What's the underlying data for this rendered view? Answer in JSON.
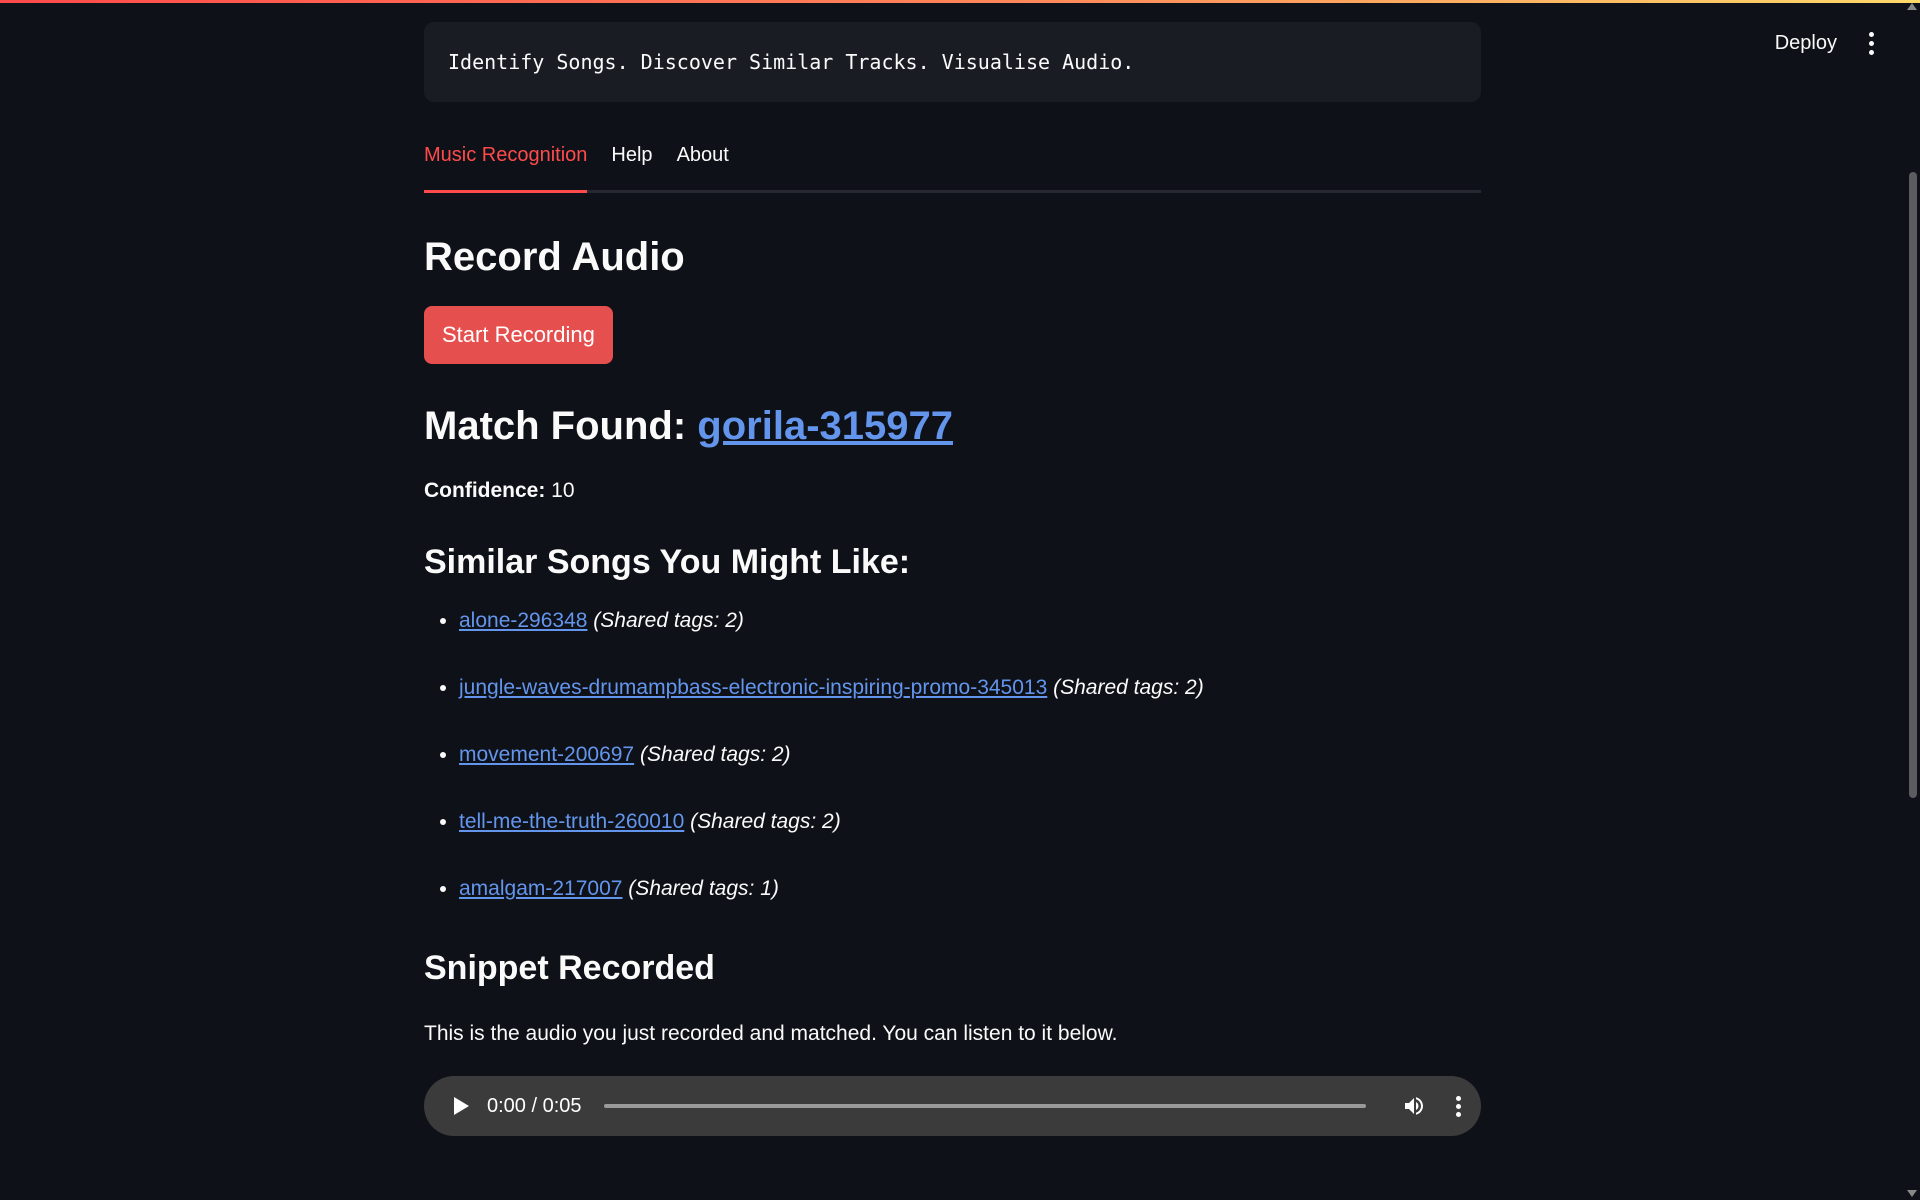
{
  "header": {
    "deploy_label": "Deploy",
    "menu_icon": "kebab-menu-icon"
  },
  "banner": {
    "text": "Identify Songs. Discover Similar Tracks. Visualise Audio."
  },
  "tabs": [
    {
      "label": "Music Recognition",
      "active": true
    },
    {
      "label": "Help",
      "active": false
    },
    {
      "label": "About",
      "active": false
    }
  ],
  "record": {
    "heading": "Record Audio",
    "button_label": "Start Recording"
  },
  "match": {
    "prefix": "Match Found: ",
    "song": "gorila-315977",
    "confidence_label": "Confidence:",
    "confidence_value": " 10"
  },
  "similar": {
    "heading": "Similar Songs You Might Like:",
    "items": [
      {
        "name": "alone-296348",
        "tags": "(Shared tags: 2)"
      },
      {
        "name": "jungle-waves-drumampbass-electronic-inspiring-promo-345013",
        "tags": "(Shared tags: 2)"
      },
      {
        "name": "movement-200697",
        "tags": "(Shared tags: 2)"
      },
      {
        "name": "tell-me-the-truth-260010",
        "tags": "(Shared tags: 2)"
      },
      {
        "name": "amalgam-217007",
        "tags": "(Shared tags: 1)"
      }
    ]
  },
  "snippet": {
    "heading": "Snippet Recorded",
    "description": "This is the audio you just recorded and matched. You can listen to it below.",
    "player": {
      "time": "0:00 / 0:05",
      "progress": 0,
      "icons": [
        "play-icon",
        "volume-icon",
        "more-options-icon"
      ]
    }
  },
  "colors": {
    "background": "#0e1117",
    "accent": "#ff4b4b",
    "button": "#e5504e",
    "link": "#6495ed",
    "banner_bg": "#1a1c24",
    "player_bg": "#3b3b3b"
  }
}
